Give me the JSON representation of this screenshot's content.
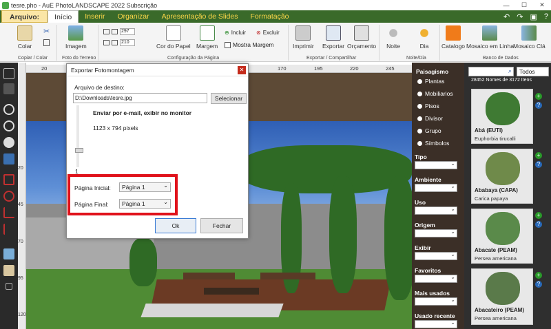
{
  "window": {
    "title": "tesre.pho - AuE PhotoLANDSCAPE 2022 Subscrição"
  },
  "menu": {
    "file": "Arquivo:",
    "items": [
      "Início",
      "Inserir",
      "Organizar",
      "Apresentação de Slides",
      "Formatação"
    ]
  },
  "ribbon": {
    "colar": "Colar",
    "imagem": "Imagem",
    "cor_papel": "Cor do Papel",
    "margem": "Margem",
    "incluir": "Incluir",
    "excluir": "Excluir",
    "mostra_margem": "Mostra Margem",
    "imprimir": "Imprimir",
    "exportar": "Exportar",
    "orcamento": "Orçamento",
    "noite": "Noite",
    "dia": "Dia",
    "catalogo": "Catalogo",
    "mosaico_linha": "Mosaico em Linha",
    "mosaico_cla": "Mosaico Clá",
    "width_val": "297",
    "height_val": "210",
    "groups": {
      "copiar": "Copiar / Colar",
      "foto": "Foto do Terreno",
      "config": "Configuração da Página",
      "exportar": "Exportar / Compartilhar",
      "noite_dia": "Noite/Dia",
      "banco": "Banco de Dados"
    }
  },
  "ruler": {
    "h": [
      "20",
      "170",
      "195",
      "220",
      "245"
    ],
    "v": [
      "20",
      "45",
      "70",
      "95",
      "120"
    ]
  },
  "dialog": {
    "title": "Exportar Fotomontagem",
    "dest_label": "Arquivo de destino:",
    "dest_value": "D:\\Downloads\\tesre.jpg",
    "select_btn": "Selecionar",
    "email_text": "Enviar por e-mail, exibir no monitor",
    "pixels": "1123 x 794 pixels",
    "scale_value": "1",
    "start_label": "Página Inicial:",
    "start_value": "Página 1",
    "end_label": "Página Final:",
    "end_value": "Página 1",
    "ok": "Ok",
    "close": "Fechar"
  },
  "categories": {
    "title": "Paisagismo",
    "items": [
      "Plantas",
      "Mobiliarios",
      "Pisos",
      "Divisor",
      "Grupo",
      "Símbolos"
    ]
  },
  "filters": [
    "Tipo",
    "Ambiente",
    "Uso",
    "Origem",
    "Exibir",
    "Favoritos",
    "Mais usados",
    "Usado recente"
  ],
  "library": {
    "filter_value": "Todos",
    "count": "28452 Nomes de 3172 Itens",
    "cards": [
      {
        "name": "Abá (EUTI)",
        "sci": "Euphorbia tirucalli"
      },
      {
        "name": "Ababaya (CAPA)",
        "sci": "Carica papaya"
      },
      {
        "name": "Abacate (PEAM)",
        "sci": "Persea americana"
      },
      {
        "name": "Abacateiro (PEAM)",
        "sci": "Persea americana"
      }
    ]
  }
}
